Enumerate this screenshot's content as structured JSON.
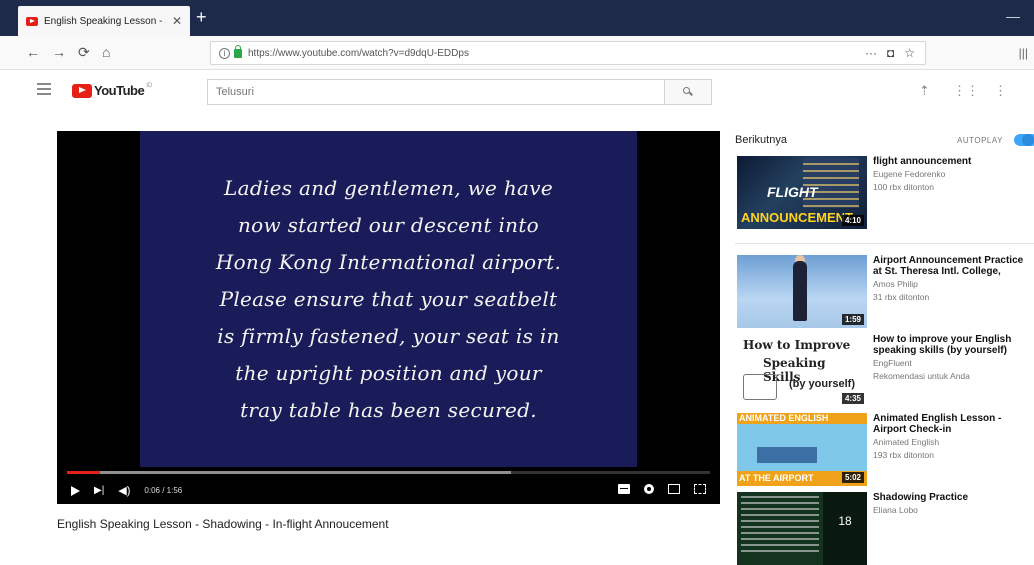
{
  "browser": {
    "tab_title": "English Speaking Lesson - Sha...",
    "tab_close": "✕",
    "new_tab": "+",
    "url": "https://www.youtube.com/watch?v=d9dqU-EDDps",
    "page_actions": "···"
  },
  "youtube": {
    "logo_text": "YouTube",
    "logo_sup": "ID",
    "search_placeholder": "Telusuri"
  },
  "player": {
    "caption_lines": [
      "Ladies and gentlemen, we have",
      "now started our descent into",
      "Hong Kong International airport.",
      "Please ensure that your seatbelt",
      "is firmly fastened, your seat is in",
      "the upright position and your",
      "tray table has been secured."
    ],
    "time": "0:06 / 1:56",
    "played_fraction": 0.052,
    "loaded_fraction": 0.69
  },
  "video_title": "English Speaking Lesson - Shadowing - In-flight Annoucement",
  "sidebar": {
    "up_next": "Berikutnya",
    "autoplay": "AUTOPLAY",
    "autoplay_on": true,
    "items": [
      {
        "title": "flight announcement",
        "channel": "Eugene Fedorenko",
        "views": "100 rbx ditonton",
        "duration": "4:10",
        "thumb_text_1": "FLIGHT",
        "thumb_text_2": "ANNOUNCEMENT"
      },
      {
        "title": "Airport Announcement Practice at St. Theresa Intl. College,",
        "channel": "Amos Philip",
        "views": "31 rbx ditonton",
        "duration": "1:59"
      },
      {
        "title": "How to improve your English speaking skills (by yourself)",
        "channel": "EngFluent",
        "views": "Rekomendasi untuk Anda",
        "duration": "4:35",
        "thumb_text_1": "How to Improve",
        "thumb_text_2": "Speaking Skills",
        "thumb_text_3": "(by yourself)"
      },
      {
        "title": "Animated English Lesson - Airport Check-in",
        "channel": "Animated English",
        "views": "193 rbx ditonton",
        "duration": "5:02",
        "thumb_text_1": "ANIMATED ENGLISH",
        "thumb_text_2": "AT THE AIRPORT"
      },
      {
        "title": "Shadowing Practice",
        "channel": "Eliana Lobo",
        "views": "",
        "thumb_text_1": "18"
      }
    ]
  }
}
